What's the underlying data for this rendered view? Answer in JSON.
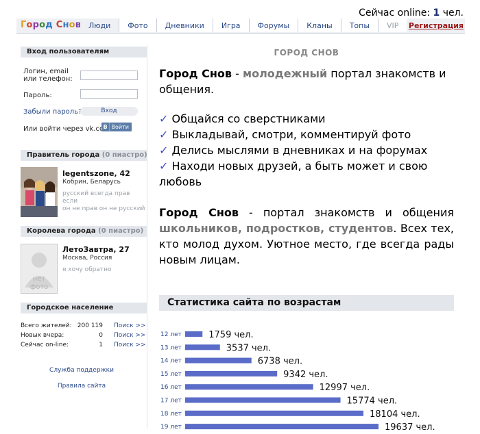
{
  "online": {
    "prefix": "Сейчас online:",
    "count": "1",
    "suffix": "чел."
  },
  "nav": {
    "logo": "Город Снов",
    "tabs": [
      "Люди",
      "Фото",
      "Дневники",
      "Игра",
      "Форумы",
      "Кланы",
      "Топы",
      "VIP"
    ],
    "register": "Регистрация"
  },
  "login": {
    "header": "Вход пользователям",
    "login_label_1": "Логин, email",
    "login_label_2": "или телефон:",
    "password_label": "Пароль:",
    "forgot": "Забыли пароль?",
    "enter": "Вход",
    "vk_text": "Или войти через vk.com:",
    "vk_icon": "В",
    "vk_button": "Войти"
  },
  "ruler": {
    "header": "Правитель города",
    "pts": "(0 пиастро)",
    "name": "legentszone, 42",
    "city": "Кобрин, Беларусь",
    "quote_1": "русский всегда прав если",
    "quote_2": "он не прав он не русский"
  },
  "queen": {
    "header": "Королева города",
    "pts": "(0 пиастро)",
    "name": "ЛетоЗавтра, 27",
    "city": "Москва, Россия",
    "quote": "я хочу обратно",
    "no_photo_1": "нет",
    "no_photo_2": "фото"
  },
  "population": {
    "header": "Городское население",
    "rows": [
      {
        "label": "Всего жителей:",
        "value": "200 119",
        "search": "Поиск >>"
      },
      {
        "label": "Новых вчера:",
        "value": "0",
        "search": "Поиск >>"
      },
      {
        "label": "Сейчас on-line:",
        "value": "1",
        "search": "Поиск >>"
      }
    ]
  },
  "links": {
    "support": "Служба поддержки",
    "rules": "Правила сайта"
  },
  "main": {
    "title": "ГОРОД СНОВ",
    "p1_bold": "Город Снов",
    "p1_dash": " - ",
    "p1_grey": "молодежный",
    "p1_rest": " портал знакомств и общения.",
    "bullets": [
      "Общайся со сверстниками",
      "Выкладывай, смотри, комментируй фото",
      "Делись мыслями в дневниках и на форумах",
      "Находи новых друзей, а быть может и свою любовь"
    ],
    "p2_bold": "Город Снов",
    "p2_a": " - портал знакомств и общения ",
    "p2_grey": "школьников, подростков, студентов",
    "p2_b": ". Всех тех, кто молод духом. Уютное место, где всегда рады новым лицам.",
    "stat_title": "Статистика сайта по возрастам"
  },
  "colors": {
    "bar": "#5a6cc8",
    "label": "#2a4a8a"
  },
  "chart_data": {
    "type": "bar",
    "title": "Статистика сайта по возрастам",
    "categories": [
      "12 лет",
      "13 лет",
      "14 лет",
      "15 лет",
      "16 лет",
      "17 лет",
      "18 лет",
      "19 лет"
    ],
    "values": [
      1759,
      3537,
      6738,
      9342,
      12997,
      15774,
      18104,
      19637
    ],
    "value_labels": [
      "1759 чел.",
      "3537 чел.",
      "6738 чел.",
      "9342 чел.",
      "12997 чел.",
      "15774 чел.",
      "18104 чел.",
      "19637 чел."
    ]
  }
}
